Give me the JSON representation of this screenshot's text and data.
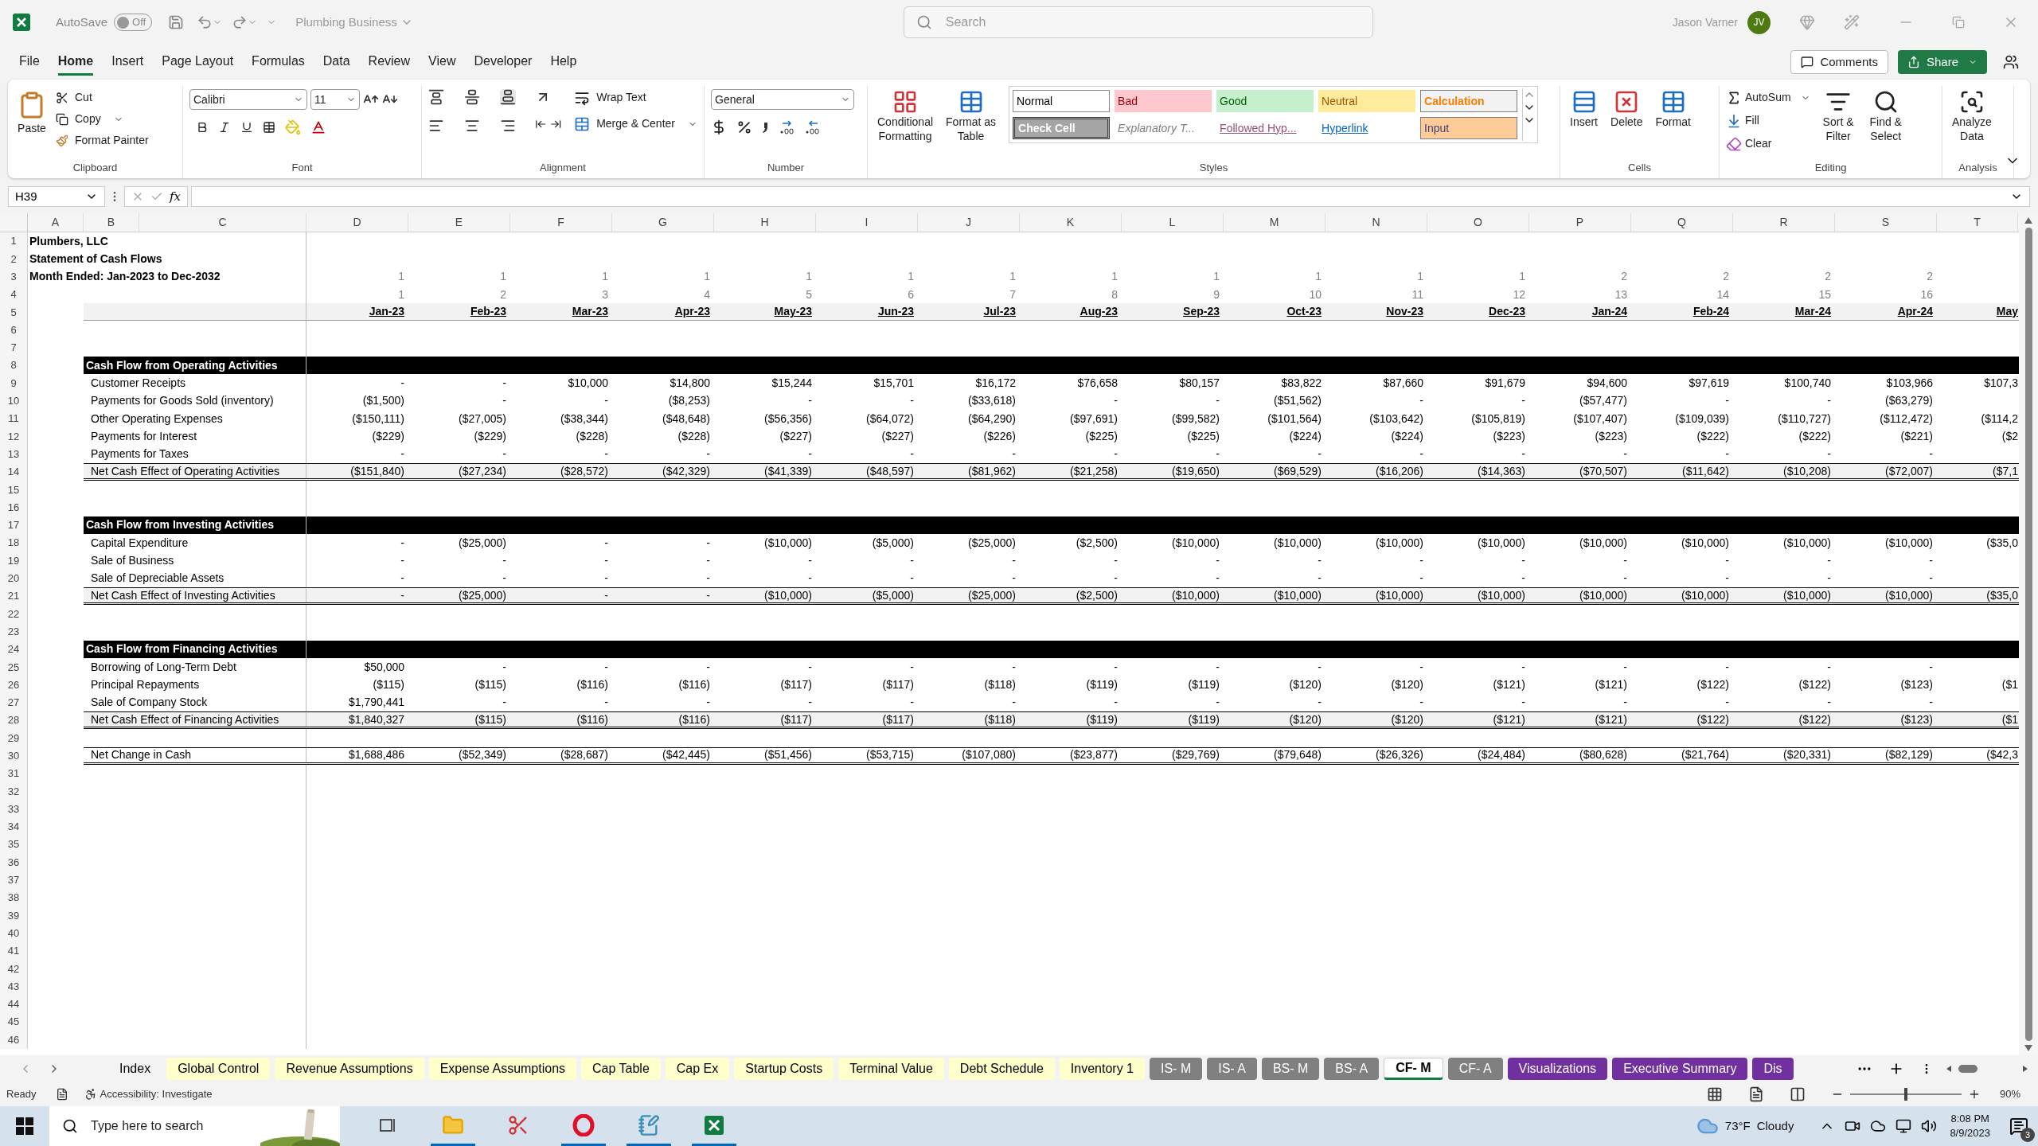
{
  "title_bar": {
    "autosave": {
      "label": "AutoSave",
      "state_label": "Off",
      "on": false
    },
    "document": "Plumbing Business",
    "search": {
      "placeholder": "Search"
    },
    "user": "Jason Varner",
    "avatar": "JV"
  },
  "menu": {
    "tabs": [
      {
        "label": "File",
        "selected": false
      },
      {
        "label": "Home",
        "selected": true
      },
      {
        "label": "Insert",
        "selected": false
      },
      {
        "label": "Page Layout",
        "selected": false
      },
      {
        "label": "Formulas",
        "selected": false
      },
      {
        "label": "Data",
        "selected": false
      },
      {
        "label": "Review",
        "selected": false
      },
      {
        "label": "View",
        "selected": false
      },
      {
        "label": "Developer",
        "selected": false
      },
      {
        "label": "Help",
        "selected": false
      }
    ],
    "comments": "Comments",
    "share": "Share"
  },
  "ribbon": {
    "clipboard": {
      "paste": "Paste",
      "cut": "Cut",
      "copy": "Copy",
      "format_painter": "Format Painter",
      "label": "Clipboard"
    },
    "font": {
      "name": "Calibri",
      "size": "11",
      "label": "Font"
    },
    "alignment": {
      "wrap_text": "Wrap Text",
      "merge": "Merge & Center",
      "label": "Alignment"
    },
    "number": {
      "format": "General",
      "label": "Number"
    },
    "styles": {
      "conditional": [
        "Conditional",
        "Formatting"
      ],
      "format_table": [
        "Format as",
        "Table"
      ],
      "label": "Styles",
      "gallery": [
        {
          "label": "Normal",
          "kind": "normal"
        },
        {
          "label": "Bad",
          "kind": "bad"
        },
        {
          "label": "Good",
          "kind": "good"
        },
        {
          "label": "Neutral",
          "kind": "neutral"
        },
        {
          "label": "Calculation",
          "kind": "calculation"
        },
        {
          "label": "Check Cell",
          "kind": "check"
        },
        {
          "label": "Explanatory T...",
          "kind": "explanatory"
        },
        {
          "label": "Followed Hyp...",
          "kind": "followed"
        },
        {
          "label": "Hyperlink",
          "kind": "hyperlink"
        },
        {
          "label": "Input",
          "kind": "input"
        }
      ]
    },
    "cells": {
      "buttons": [
        "Insert",
        "Delete",
        "Format"
      ],
      "label": "Cells"
    },
    "editing": {
      "autosum": "AutoSum",
      "fill": "Fill",
      "clear": "Clear",
      "sort": [
        "Sort &",
        "Filter"
      ],
      "find": [
        "Find &",
        "Select"
      ],
      "label": "Editing"
    },
    "analysis": {
      "analyze": [
        "Analyze",
        "Data"
      ],
      "label": "Analysis"
    }
  },
  "formula_bar": {
    "name_box": "H39",
    "fx": "fx"
  },
  "sheet": {
    "columns": [
      "A",
      "B",
      "C",
      "D",
      "E",
      "F",
      "G",
      "H",
      "I",
      "J",
      "K",
      "L",
      "M",
      "N",
      "O",
      "P",
      "Q",
      "R",
      "S",
      "T"
    ],
    "rows": [
      {
        "n": "1",
        "kind": "title",
        "text": "Plumbers, LLC"
      },
      {
        "n": "2",
        "kind": "title",
        "text": "Statement of Cash Flows"
      },
      {
        "n": "3",
        "kind": "title",
        "text": "Month Ended: Jan-2023 to Dec-2032",
        "values": [
          "1",
          "1",
          "1",
          "1",
          "1",
          "1",
          "1",
          "1",
          "1",
          "1",
          "1",
          "1",
          "2",
          "2",
          "2",
          "2"
        ]
      },
      {
        "n": "4",
        "kind": "index",
        "values": [
          "1",
          "2",
          "3",
          "4",
          "5",
          "6",
          "7",
          "8",
          "9",
          "10",
          "11",
          "12",
          "13",
          "14",
          "15",
          "16"
        ]
      },
      {
        "n": "5",
        "kind": "dates",
        "values": [
          "Jan-23",
          "Feb-23",
          "Mar-23",
          "Apr-23",
          "May-23",
          "Jun-23",
          "Jul-23",
          "Aug-23",
          "Sep-23",
          "Oct-23",
          "Nov-23",
          "Dec-23",
          "Jan-24",
          "Feb-24",
          "Mar-24",
          "Apr-24",
          "May"
        ]
      },
      {
        "n": "6",
        "kind": "blank"
      },
      {
        "n": "7",
        "kind": "blank"
      },
      {
        "n": "8",
        "kind": "section",
        "text": "Cash Flow from Operating Activities"
      },
      {
        "n": "9",
        "kind": "item",
        "text": "Customer Receipts",
        "values": [
          "-",
          "-",
          "$10,000",
          "$14,800",
          "$15,244",
          "$15,701",
          "$16,172",
          "$76,658",
          "$80,157",
          "$83,822",
          "$87,660",
          "$91,679",
          "$94,600",
          "$97,619",
          "$100,740",
          "$103,966",
          "$107,3"
        ]
      },
      {
        "n": "10",
        "kind": "item",
        "text": "Payments for Goods Sold (inventory)",
        "values": [
          "($1,500)",
          "-",
          "-",
          "($8,253)",
          "-",
          "-",
          "($33,618)",
          "-",
          "-",
          "($51,562)",
          "-",
          "-",
          "($57,477)",
          "-",
          "-",
          "($63,279)"
        ]
      },
      {
        "n": "11",
        "kind": "item",
        "text": "Other Operating Expenses",
        "values": [
          "($150,111)",
          "($27,005)",
          "($38,344)",
          "($48,648)",
          "($56,356)",
          "($64,072)",
          "($64,290)",
          "($97,691)",
          "($99,582)",
          "($101,564)",
          "($103,642)",
          "($105,819)",
          "($107,407)",
          "($109,039)",
          "($110,727)",
          "($112,472)",
          "($114,2"
        ]
      },
      {
        "n": "12",
        "kind": "item",
        "text": "Payments for Interest",
        "values": [
          "($229)",
          "($229)",
          "($228)",
          "($228)",
          "($227)",
          "($227)",
          "($226)",
          "($225)",
          "($225)",
          "($224)",
          "($224)",
          "($223)",
          "($223)",
          "($222)",
          "($222)",
          "($221)",
          "($2"
        ]
      },
      {
        "n": "13",
        "kind": "item",
        "text": "Payments for Taxes",
        "values": [
          "-",
          "-",
          "-",
          "-",
          "-",
          "-",
          "-",
          "-",
          "-",
          "-",
          "-",
          "-",
          "-",
          "-",
          "-",
          "-"
        ]
      },
      {
        "n": "14",
        "kind": "total",
        "text": "Net Cash Effect of Operating Activities",
        "values": [
          "($151,840)",
          "($27,234)",
          "($28,572)",
          "($42,329)",
          "($41,339)",
          "($48,597)",
          "($81,962)",
          "($21,258)",
          "($19,650)",
          "($69,529)",
          "($16,206)",
          "($14,363)",
          "($70,507)",
          "($11,642)",
          "($10,208)",
          "($72,007)",
          "($7,1"
        ]
      },
      {
        "n": "15",
        "kind": "blank"
      },
      {
        "n": "16",
        "kind": "blank"
      },
      {
        "n": "17",
        "kind": "section",
        "text": "Cash Flow from Investing Activities"
      },
      {
        "n": "18",
        "kind": "item",
        "text": "Capital Expenditure",
        "values": [
          "-",
          "($25,000)",
          "-",
          "-",
          "($10,000)",
          "($5,000)",
          "($25,000)",
          "($2,500)",
          "($10,000)",
          "($10,000)",
          "($10,000)",
          "($10,000)",
          "($10,000)",
          "($10,000)",
          "($10,000)",
          "($10,000)",
          "($35,0"
        ]
      },
      {
        "n": "19",
        "kind": "item",
        "text": "Sale of Business",
        "values": [
          "-",
          "-",
          "-",
          "-",
          "-",
          "-",
          "-",
          "-",
          "-",
          "-",
          "-",
          "-",
          "-",
          "-",
          "-",
          "-"
        ]
      },
      {
        "n": "20",
        "kind": "item",
        "text": "Sale of Depreciable Assets",
        "values": [
          "-",
          "-",
          "-",
          "-",
          "-",
          "-",
          "-",
          "-",
          "-",
          "-",
          "-",
          "-",
          "-",
          "-",
          "-",
          "-"
        ]
      },
      {
        "n": "21",
        "kind": "total",
        "text": "Net Cash Effect of Investing Activities",
        "values": [
          "-",
          "($25,000)",
          "-",
          "-",
          "($10,000)",
          "($5,000)",
          "($25,000)",
          "($2,500)",
          "($10,000)",
          "($10,000)",
          "($10,000)",
          "($10,000)",
          "($10,000)",
          "($10,000)",
          "($10,000)",
          "($10,000)",
          "($35,0"
        ]
      },
      {
        "n": "22",
        "kind": "blank"
      },
      {
        "n": "23",
        "kind": "blank"
      },
      {
        "n": "24",
        "kind": "section",
        "text": "Cash Flow from Financing Activities"
      },
      {
        "n": "25",
        "kind": "item",
        "text": "Borrowing of Long-Term Debt",
        "values": [
          "$50,000",
          "-",
          "-",
          "-",
          "-",
          "-",
          "-",
          "-",
          "-",
          "-",
          "-",
          "-",
          "-",
          "-",
          "-",
          "-"
        ]
      },
      {
        "n": "26",
        "kind": "item",
        "text": "Principal Repayments",
        "values": [
          "($115)",
          "($115)",
          "($116)",
          "($116)",
          "($117)",
          "($117)",
          "($118)",
          "($119)",
          "($119)",
          "($120)",
          "($120)",
          "($121)",
          "($121)",
          "($122)",
          "($122)",
          "($123)",
          "($1"
        ]
      },
      {
        "n": "27",
        "kind": "item",
        "text": "Sale of Company Stock",
        "values": [
          "$1,790,441",
          "-",
          "-",
          "-",
          "-",
          "-",
          "-",
          "-",
          "-",
          "-",
          "-",
          "-",
          "-",
          "-",
          "-",
          "-"
        ]
      },
      {
        "n": "28",
        "kind": "total",
        "text": "Net Cash Effect of Financing Activities",
        "values": [
          "$1,840,327",
          "($115)",
          "($116)",
          "($116)",
          "($117)",
          "($117)",
          "($118)",
          "($119)",
          "($119)",
          "($120)",
          "($120)",
          "($121)",
          "($121)",
          "($122)",
          "($122)",
          "($123)",
          "($1"
        ]
      },
      {
        "n": "29",
        "kind": "blank"
      },
      {
        "n": "30",
        "kind": "net",
        "text": "Net Change in Cash",
        "values": [
          "$1,688,486",
          "($52,349)",
          "($28,687)",
          "($42,445)",
          "($51,456)",
          "($53,715)",
          "($107,080)",
          "($23,877)",
          "($29,769)",
          "($79,648)",
          "($26,326)",
          "($24,484)",
          "($80,628)",
          "($21,764)",
          "($20,331)",
          "($82,129)",
          "($42,3"
        ]
      },
      {
        "n": "31",
        "kind": "blank"
      },
      {
        "n": "32",
        "kind": "blank"
      },
      {
        "n": "33",
        "kind": "blank"
      },
      {
        "n": "34",
        "kind": "blank"
      },
      {
        "n": "35",
        "kind": "blank"
      },
      {
        "n": "36",
        "kind": "blank"
      },
      {
        "n": "37",
        "kind": "blank"
      },
      {
        "n": "38",
        "kind": "blank"
      },
      {
        "n": "39",
        "kind": "blank"
      },
      {
        "n": "40",
        "kind": "blank"
      },
      {
        "n": "41",
        "kind": "blank"
      },
      {
        "n": "42",
        "kind": "blank"
      },
      {
        "n": "43",
        "kind": "blank"
      },
      {
        "n": "44",
        "kind": "blank"
      },
      {
        "n": "45",
        "kind": "blank"
      },
      {
        "n": "46",
        "kind": "blank"
      }
    ]
  },
  "sheet_tabs": [
    {
      "label": "Index",
      "selected": false
    },
    {
      "label": "Global Control",
      "selected": false,
      "color": "#ffffcc"
    },
    {
      "label": "Revenue Assumptions",
      "selected": false,
      "color": "#ffffcc"
    },
    {
      "label": "Expense Assumptions",
      "selected": false,
      "color": "#ffffcc"
    },
    {
      "label": "Cap Table",
      "selected": false,
      "color": "#ffffcc"
    },
    {
      "label": "Cap Ex",
      "selected": false,
      "color": "#ffffcc"
    },
    {
      "label": "Startup Costs",
      "selected": false,
      "color": "#ffffcc"
    },
    {
      "label": "Terminal Value",
      "selected": false,
      "color": "#ffffcc"
    },
    {
      "label": "Debt Schedule",
      "selected": false,
      "color": "#ffffcc"
    },
    {
      "label": "Inventory 1",
      "selected": false,
      "color": "#ffffcc"
    },
    {
      "label": "IS- M",
      "selected": false,
      "color": "#808080"
    },
    {
      "label": "IS- A",
      "selected": false,
      "color": "#808080"
    },
    {
      "label": "BS- M",
      "selected": false,
      "color": "#808080"
    },
    {
      "label": "BS- A",
      "selected": false,
      "color": "#808080"
    },
    {
      "label": "CF- M",
      "selected": true
    },
    {
      "label": "CF- A",
      "selected": false,
      "color": "#808080"
    },
    {
      "label": "Visualizations",
      "selected": false,
      "color": "#7030a0"
    },
    {
      "label": "Executive Summary",
      "selected": false,
      "color": "#7030a0"
    },
    {
      "label": "Dis",
      "selected": false,
      "color": "#7030a0"
    }
  ],
  "status_bar": {
    "mode": "Ready",
    "accessibility": "Accessibility: Investigate",
    "zoom": "90%",
    "zoom_slider": {
      "level": 0.5
    }
  },
  "taskbar": {
    "search_placeholder": "Type here to search",
    "apps": [
      {
        "kind": "taskview",
        "running": false
      },
      {
        "kind": "explorer",
        "running": true
      },
      {
        "kind": "snipping",
        "running": false
      },
      {
        "kind": "opera",
        "running": true
      },
      {
        "kind": "notepad",
        "running": true
      },
      {
        "kind": "excel",
        "running": true
      }
    ],
    "weather": {
      "temp": "73°F",
      "condition": "Cloudy"
    },
    "time": "8:08 PM",
    "date": "8/9/2023",
    "notifications": "3"
  }
}
